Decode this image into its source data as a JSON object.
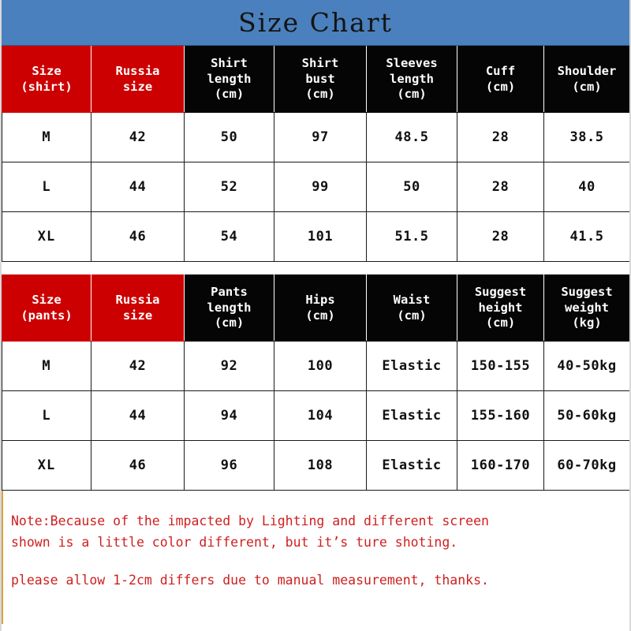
{
  "title": "Size Chart",
  "colors": {
    "banner": "#4a80bd",
    "header_red": "#cc0000",
    "header_black": "#050505",
    "note_text": "#cf2020",
    "note_rule": "#d9a23a"
  },
  "shirt_table": {
    "headers": [
      "Size\n(shirt)",
      "Russia\nsize",
      "Shirt\nlength\n(cm)",
      "Shirt\nbust\n(cm)",
      "Sleeves\nlength\n(cm)",
      "Cuff\n(cm)",
      "Shoulder\n(cm)"
    ],
    "header_styles": [
      "red",
      "red",
      "black",
      "black",
      "black",
      "black",
      "black"
    ],
    "rows": [
      [
        "M",
        "42",
        "50",
        "97",
        "48.5",
        "28",
        "38.5"
      ],
      [
        "L",
        "44",
        "52",
        "99",
        "50",
        "28",
        "40"
      ],
      [
        "XL",
        "46",
        "54",
        "101",
        "51.5",
        "28",
        "41.5"
      ]
    ]
  },
  "pants_table": {
    "headers": [
      "Size\n(pants)",
      "Russia\nsize",
      "Pants\nlength\n(cm)",
      "Hips\n(cm)",
      "Waist\n(cm)",
      "Suggest\nheight\n(cm)",
      "Suggest\nweight\n(kg)"
    ],
    "header_styles": [
      "red",
      "red",
      "black",
      "black",
      "black",
      "black",
      "black"
    ],
    "rows": [
      [
        "M",
        "42",
        "92",
        "100",
        "Elastic",
        "150-155",
        "40-50kg"
      ],
      [
        "L",
        "44",
        "94",
        "104",
        "Elastic",
        "155-160",
        "50-60kg"
      ],
      [
        "XL",
        "46",
        "96",
        "108",
        "Elastic",
        "160-170",
        "60-70kg"
      ]
    ]
  },
  "notes": [
    {
      "lines": [
        "Note:Because of the impacted by Lighting and different screen",
        "shown is a little color different, but it’s ture shoting."
      ]
    },
    {
      "lines": [
        "please allow 1-2cm differs due to manual measurement, thanks."
      ]
    }
  ]
}
